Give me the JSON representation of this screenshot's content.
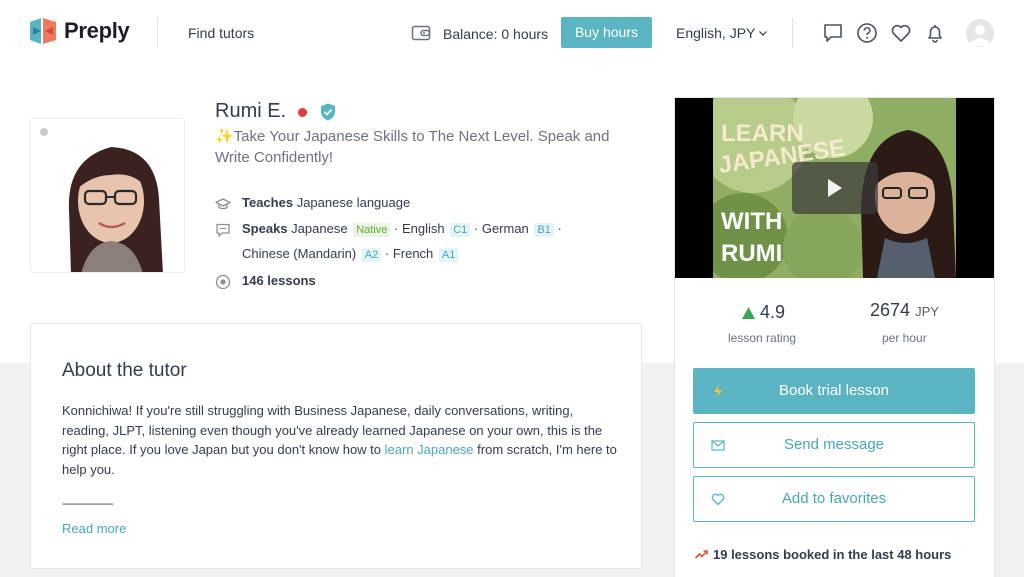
{
  "header": {
    "logo_text": "Preply",
    "find_tutors": "Find tutors",
    "balance": "Balance: 0 hours",
    "buy_hours": "Buy hours",
    "language_currency": "English, JPY",
    "accent_color": "#5ab4c2"
  },
  "tutor": {
    "name": "Rumi E.",
    "headline": "✨Take Your Japanese Skills to The Next Level. Speak and Write Confidently!",
    "teaches_label": "Teaches",
    "teaches_value": "Japanese language",
    "speaks_label": "Speaks",
    "languages": [
      {
        "name": "Japanese",
        "level": "Native"
      },
      {
        "name": "English",
        "level": "C1"
      },
      {
        "name": "German",
        "level": "B1"
      },
      {
        "name": "Chinese (Mandarin)",
        "level": "A2"
      },
      {
        "name": "French",
        "level": "A1"
      }
    ],
    "lessons": "146 lessons"
  },
  "about": {
    "title": "About the tutor",
    "text_before_link": "Konnichiwa! If you're still struggling with Business Japanese, daily conversations, writing, reading, JLPT, listening even though you've already learned Japanese on your own, this is the right place. If you love Japan but you don't know how to ",
    "link_text": "learn Japanese",
    "text_after_link": " from scratch, I'm here to help you.",
    "separator": "-------------------",
    "read_more": "Read more"
  },
  "video": {
    "overlay_line1": "LEARN",
    "overlay_line2": "JAPANESE",
    "overlay_line3": "WITH",
    "overlay_line4": "RUMI"
  },
  "stats": {
    "rating": "4.9",
    "rating_label": "lesson rating",
    "price": "2674",
    "currency": "JPY",
    "price_label": "per hour"
  },
  "actions": {
    "book_trial": "Book trial lesson",
    "send_message": "Send message",
    "add_favorites": "Add to favorites"
  },
  "booked_text": "19 lessons booked in the last 48 hours"
}
